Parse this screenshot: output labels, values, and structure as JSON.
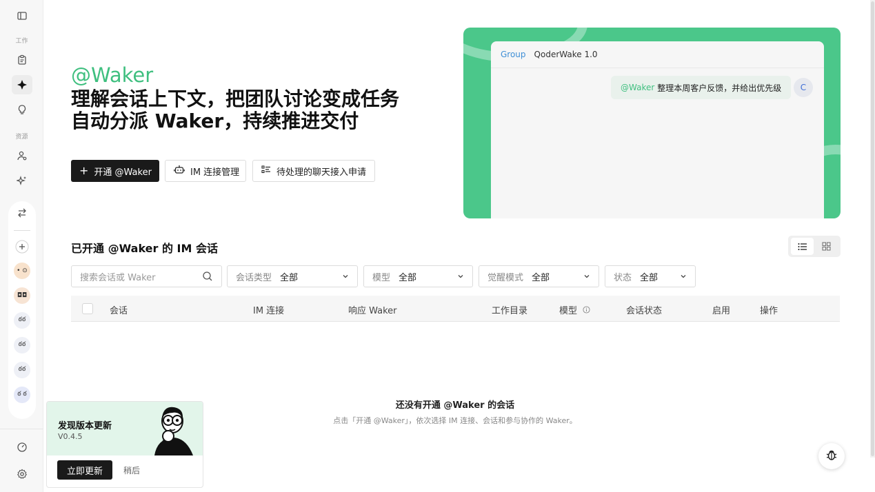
{
  "sidebar": {
    "section_work": "工作",
    "section_resources": "资源",
    "avatars": [
      {
        "initials": "• ⊙",
        "bg": "#f8e2cc"
      },
      {
        "initials": "◘◘",
        "bg": "#f7e4d4"
      },
      {
        "initials": "ఠఠ",
        "bg": "#eef0f6"
      },
      {
        "initials": "ఠఠ",
        "bg": "#eef0f6"
      },
      {
        "initials": "ఠఠ",
        "bg": "#eef0f6"
      },
      {
        "initials": "ఠ ఠ",
        "bg": "#e4e8f8"
      }
    ]
  },
  "hero": {
    "mention": "@Waker",
    "line1": "理解会话上下文，把团队讨论变成任务",
    "line2": "自动分派 Waker，持续推进交付"
  },
  "actions": {
    "enable": "开通 @Waker",
    "im_manage": "IM 连接管理",
    "pending": "待处理的聊天接入申请"
  },
  "preview": {
    "tab": "Group",
    "title": "QoderWake 1.0",
    "mention": "@Waker",
    "message": "整理本周客户反馈，并给出优先级",
    "avatar_initial": "C"
  },
  "section": {
    "title": "已开通 @Waker 的 IM 会话"
  },
  "filters": {
    "search_placeholder": "搜索会话或 Waker",
    "items": [
      {
        "label": "会话类型",
        "value": "全部"
      },
      {
        "label": "模型",
        "value": "全部"
      },
      {
        "label": "觉醒模式",
        "value": "全部"
      },
      {
        "label": "状态",
        "value": "全部"
      }
    ]
  },
  "table": {
    "columns": [
      "会话",
      "IM 连接",
      "响应 Waker",
      "工作目录",
      "模型",
      "会话状态",
      "启用",
      "操作"
    ]
  },
  "empty": {
    "title": "还没有开通 @Waker 的会话",
    "description": "点击「开通 @Waker」，依次选择 IM 连接、会话和参与协作的 Waker。"
  },
  "update_card": {
    "title": "发现版本更新",
    "version": "V0.4.5",
    "update_now": "立即更新",
    "later": "稍后"
  },
  "colors": {
    "accent_green": "#3fbf7f",
    "preview_bg": "#4bc78a",
    "primary_dark": "#1a1a1a"
  }
}
